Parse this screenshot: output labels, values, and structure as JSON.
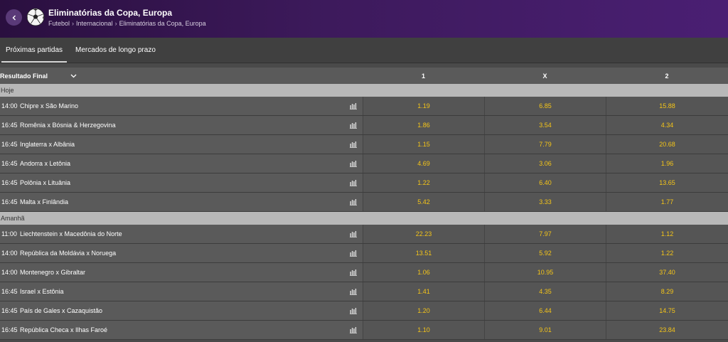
{
  "header": {
    "title": "Eliminatórias da Copa, Europa",
    "breadcrumb": [
      "Futebol",
      "Internacional",
      "Eliminatórias da Copa, Europa"
    ]
  },
  "tabs": [
    {
      "label": "Próximas partidas",
      "active": true
    },
    {
      "label": "Mercados de longo prazo",
      "active": false
    }
  ],
  "market": {
    "label": "Resultado Final",
    "col1": "1",
    "colx": "X",
    "col2": "2"
  },
  "days": [
    {
      "label": "Hoje",
      "matches": [
        {
          "time": "14:00",
          "teams": "Chipre x São Marino",
          "o1": "1.19",
          "ox": "6.85",
          "o2": "15.88"
        },
        {
          "time": "16:45",
          "teams": "Romênia x Bósnia & Herzegovina",
          "o1": "1.86",
          "ox": "3.54",
          "o2": "4.34"
        },
        {
          "time": "16:45",
          "teams": "Inglaterra x Albânia",
          "o1": "1.15",
          "ox": "7.79",
          "o2": "20.68"
        },
        {
          "time": "16:45",
          "teams": "Andorra x Letônia",
          "o1": "4.69",
          "ox": "3.06",
          "o2": "1.96"
        },
        {
          "time": "16:45",
          "teams": "Polônia x Lituânia",
          "o1": "1.22",
          "ox": "6.40",
          "o2": "13.65"
        },
        {
          "time": "16:45",
          "teams": "Malta x Finlândia",
          "o1": "5.42",
          "ox": "3.33",
          "o2": "1.77"
        }
      ]
    },
    {
      "label": "Amanhã",
      "matches": [
        {
          "time": "11:00",
          "teams": "Liechtenstein x Macedônia do Norte",
          "o1": "22.23",
          "ox": "7.97",
          "o2": "1.12"
        },
        {
          "time": "14:00",
          "teams": "República da Moldávia x Noruega",
          "o1": "13.51",
          "ox": "5.92",
          "o2": "1.22"
        },
        {
          "time": "14:00",
          "teams": "Montenegro x Gibraltar",
          "o1": "1.06",
          "ox": "10.95",
          "o2": "37.40"
        },
        {
          "time": "16:45",
          "teams": "Israel x Estônia",
          "o1": "1.41",
          "ox": "4.35",
          "o2": "8.29"
        },
        {
          "time": "16:45",
          "teams": "País de Gales x Cazaquistão",
          "o1": "1.20",
          "ox": "6.44",
          "o2": "14.75"
        },
        {
          "time": "16:45",
          "teams": "República Checa x Ilhas Faroé",
          "o1": "1.10",
          "ox": "9.01",
          "o2": "23.84"
        }
      ]
    }
  ],
  "icons": {
    "back": "chevron-left-icon",
    "sport": "soccer-ball-icon",
    "breadcrumb_sep": "chevron-right-icon",
    "market_toggle": "chevron-down-icon",
    "stats": "bar-chart-icon"
  },
  "colors": {
    "odds": "#f5c518",
    "header_start": "#2a0f3f",
    "header_end": "#4a1f73"
  }
}
